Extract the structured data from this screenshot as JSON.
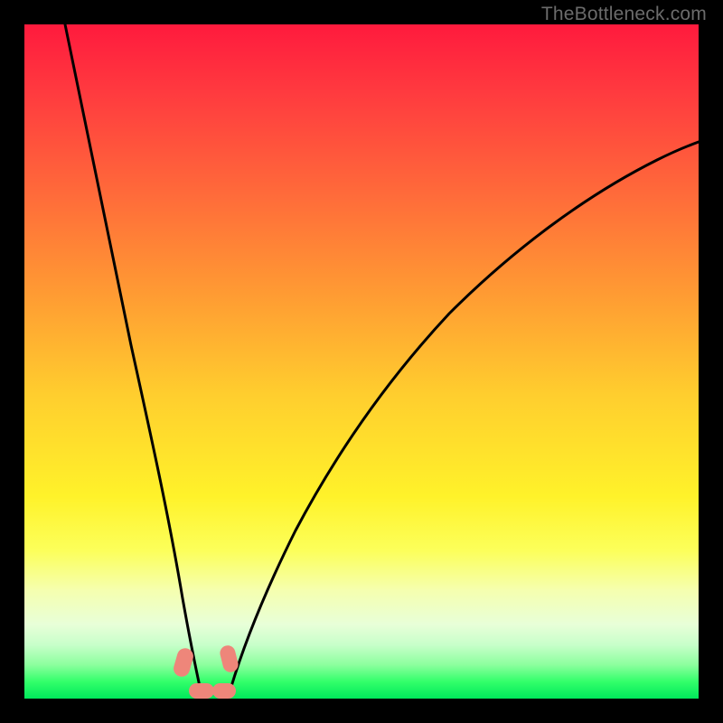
{
  "watermark": "TheBottleneck.com",
  "colors": {
    "frame": "#000000",
    "watermark": "#6b6b6b",
    "curve": "#000000",
    "blob": "#ee867a",
    "gradient_top": "#ff1a3d",
    "gradient_bottom": "#00e85b"
  },
  "chart_data": {
    "type": "line",
    "title": "",
    "xlabel": "",
    "ylabel": "",
    "xlim": [
      0,
      100
    ],
    "ylim": [
      0,
      100
    ],
    "grid": false,
    "annotations": [],
    "series": [
      {
        "name": "left-curve",
        "x": [
          6,
          8,
          10,
          12,
          14,
          16,
          18,
          20,
          22,
          23.5,
          25
        ],
        "values": [
          100,
          85,
          71,
          58,
          46,
          35,
          25,
          16,
          9,
          4,
          0
        ]
      },
      {
        "name": "right-curve",
        "x": [
          30,
          32,
          35,
          38,
          42,
          46,
          50,
          55,
          60,
          66,
          73,
          80,
          88,
          96,
          100
        ],
        "values": [
          0,
          4,
          11,
          18,
          26,
          33,
          40,
          47,
          53,
          59,
          65,
          70,
          76,
          81,
          83
        ]
      }
    ],
    "markers": [
      {
        "name": "blob-left",
        "x": 23.5,
        "y": 4.5
      },
      {
        "name": "blob-right",
        "x": 30,
        "y": 5
      },
      {
        "name": "blob-bottom-left",
        "x": 25,
        "y": 1
      },
      {
        "name": "blob-bottom-right",
        "x": 29,
        "y": 1
      }
    ]
  }
}
